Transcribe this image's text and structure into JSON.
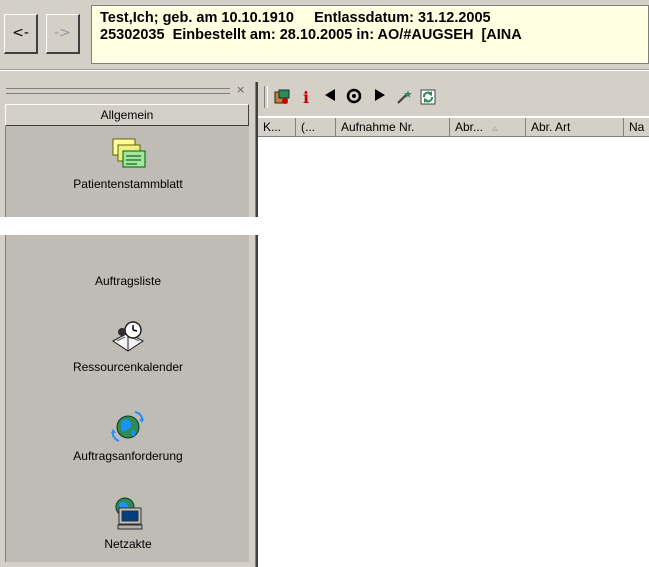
{
  "nav": {
    "back_label": "<-",
    "forward_label": "->"
  },
  "patient": {
    "line1": "Test,Ich; geb. am 10.10.1910     Entlassdatum: 31.12.2005",
    "line2": "25302035  Einbestellt am: 28.10.2005 in: AO/#AUGSEH  [AINA"
  },
  "sidebar": {
    "close_label": "×",
    "section_label": "Allgemein",
    "items": [
      {
        "label": "Patientenstammblatt",
        "icon": "patient-card-icon"
      },
      {
        "label": "Auftragsliste",
        "icon": "order-list-icon"
      },
      {
        "label": "Ressourcenkalender",
        "icon": "calendar-clock-icon"
      },
      {
        "label": "Auftragsanforderung",
        "icon": "globe-arrows-icon"
      },
      {
        "label": "Netzakte",
        "icon": "network-computer-icon"
      }
    ]
  },
  "toolbar": {
    "icons": [
      "case-icon",
      "info-icon",
      "prev-icon",
      "record-icon",
      "next-icon",
      "magic-wand-icon",
      "refresh-icon"
    ],
    "info_label": "i"
  },
  "table": {
    "columns": [
      "K...",
      "(...",
      "Aufnahme Nr.",
      "Abr...",
      "Abr. Art",
      "Na"
    ]
  },
  "colors": {
    "window": "#d4d0c8",
    "tooltip": "#ffffe1",
    "panel_inner": "#bfbcb6",
    "info_red": "#cc0000"
  }
}
